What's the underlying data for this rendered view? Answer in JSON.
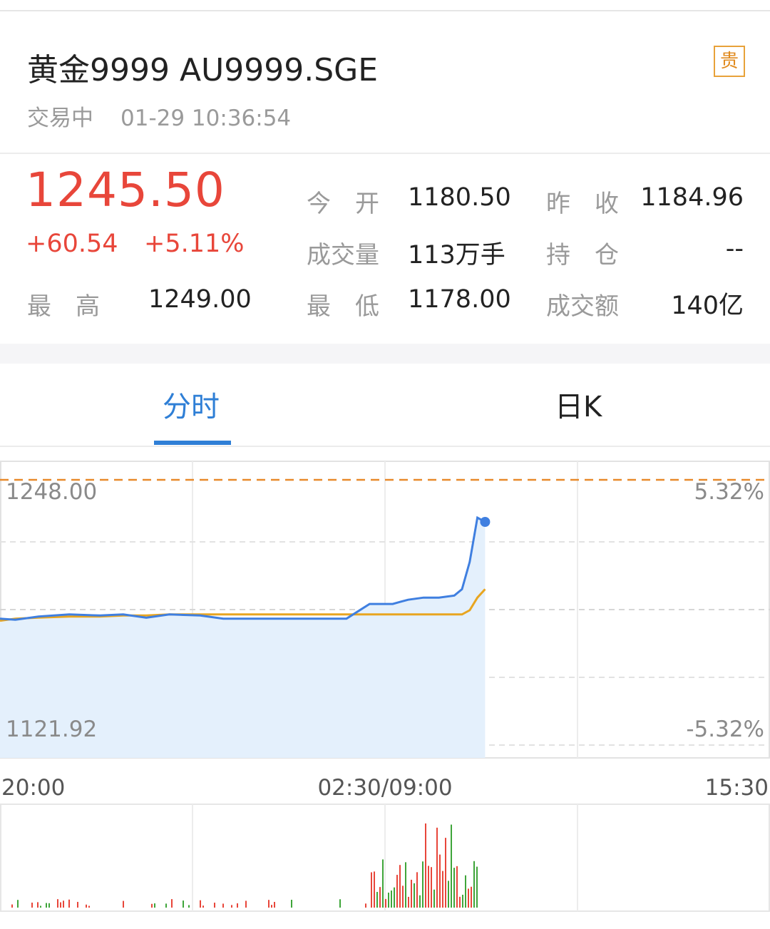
{
  "header": {
    "title": "黄金9999 AU9999.SGE",
    "badge": "贵",
    "status": "交易中",
    "timestamp": "01-29 10:36:54"
  },
  "quote": {
    "price": "1245.50",
    "change": "+60.54",
    "change_pct": "+5.11%",
    "high_label": "最　高",
    "high": "1249.00",
    "open_label": "今　开",
    "open": "1180.50",
    "prev_close_label": "昨　收",
    "prev_close": "1184.96",
    "volume_label": "成交量",
    "volume": "113万手",
    "position_label": "持　仓",
    "position": "--",
    "low_label": "最　低",
    "low": "1178.00",
    "turnover_label": "成交额",
    "turnover": "140亿"
  },
  "tabs": [
    {
      "label": "分时",
      "active": true
    },
    {
      "label": "日K",
      "active": false
    }
  ],
  "chart_data": {
    "type": "line",
    "y_max_label": "1248.00",
    "y_min_label": "1121.92",
    "pct_max_label": "5.32%",
    "pct_min_label": "-5.32%",
    "x_labels": [
      "20:00",
      "02:30/09:00",
      "15:30"
    ],
    "ylim": [
      1121.92,
      1248.0
    ],
    "prev_close": 1184.96,
    "price_series": {
      "name": "",
      "x": [
        0,
        2,
        5,
        9,
        13,
        16,
        19,
        22,
        26,
        29,
        32,
        35,
        39,
        42,
        45,
        48,
        49,
        49.5,
        50,
        51,
        52,
        53,
        55,
        57,
        59,
        60,
        61,
        62,
        63
      ],
      "values": [
        1182,
        1181.5,
        1183,
        1184,
        1183.5,
        1184,
        1182.5,
        1184,
        1183.5,
        1182,
        1182,
        1182,
        1182,
        1182,
        1182,
        1189,
        1189,
        1189,
        1189,
        1189,
        1190,
        1191,
        1192,
        1192,
        1193,
        1196,
        1209,
        1230,
        1228
      ]
    },
    "avg_series": {
      "name": "",
      "values": [
        1181,
        1182,
        1182.5,
        1183,
        1183,
        1183.5,
        1183.5,
        1184,
        1184,
        1184,
        1184,
        1184,
        1184,
        1184,
        1184,
        1184,
        1184,
        1184,
        1184,
        1184,
        1184,
        1184,
        1184,
        1184,
        1184,
        1184,
        1186,
        1192,
        1196
      ]
    },
    "colors": {
      "price": "#3f7fe0",
      "avg": "#e8a520",
      "fill": "#e4f0fc",
      "high_line": "#e8892a",
      "volume_up": "#e8463a",
      "volume_down": "#3fa53a"
    }
  }
}
